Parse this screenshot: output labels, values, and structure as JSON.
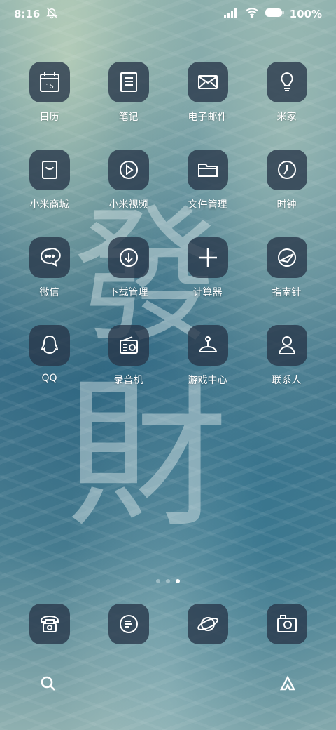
{
  "status_bar": {
    "time": "8:16",
    "battery_text": "100%",
    "icons": [
      "mute-bell-icon",
      "signal-icon",
      "wifi-icon",
      "battery-icon"
    ]
  },
  "apps": [
    {
      "label": "日历",
      "icon": "calendar-icon",
      "badge": "15"
    },
    {
      "label": "笔记",
      "icon": "notes-icon"
    },
    {
      "label": "电子邮件",
      "icon": "email-icon"
    },
    {
      "label": "米家",
      "icon": "lightbulb-icon"
    },
    {
      "label": "小米商城",
      "icon": "shopping-bag-icon"
    },
    {
      "label": "小米视频",
      "icon": "video-play-icon"
    },
    {
      "label": "文件管理",
      "icon": "folder-icon"
    },
    {
      "label": "时钟",
      "icon": "clock-icon"
    },
    {
      "label": "微信",
      "icon": "chat-icon"
    },
    {
      "label": "下载管理",
      "icon": "download-icon"
    },
    {
      "label": "计算器",
      "icon": "plus-icon"
    },
    {
      "label": "指南针",
      "icon": "compass-icon"
    },
    {
      "label": "QQ",
      "icon": "qq-penguin-icon"
    },
    {
      "label": "录音机",
      "icon": "radio-icon"
    },
    {
      "label": "游戏中心",
      "icon": "joystick-icon"
    },
    {
      "label": "联系人",
      "icon": "contact-person-icon"
    }
  ],
  "page_indicator": {
    "count": 3,
    "active": 3
  },
  "dock": [
    {
      "icon": "telephone-icon"
    },
    {
      "icon": "message-icon"
    },
    {
      "icon": "browser-planet-icon"
    },
    {
      "icon": "camera-icon"
    }
  ],
  "search_bar": {
    "left_icon": "search-icon",
    "right_icon": "assistant-icon"
  },
  "wallpaper": {
    "large_characters": [
      "發",
      "財"
    ]
  },
  "colors": {
    "icon_background": "#263448",
    "text": "#ffffff"
  }
}
